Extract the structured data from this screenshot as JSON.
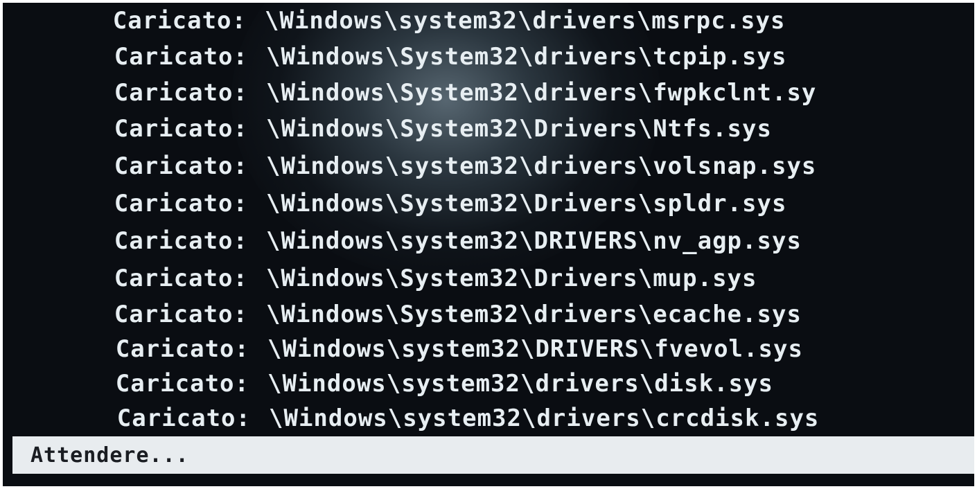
{
  "boot_log": {
    "label": "Caricato:",
    "entries": [
      {
        "prefix": "Caricato:",
        "path": "\\Windows\\system32\\drivers\\msrpc.sys"
      },
      {
        "prefix": "Caricato:",
        "path": "\\Windows\\System32\\drivers\\tcpip.sys"
      },
      {
        "prefix": "Caricato:",
        "path": "\\Windows\\System32\\drivers\\fwpkclnt.sy"
      },
      {
        "prefix": "Caricato:",
        "path": "\\Windows\\System32\\Drivers\\Ntfs.sys"
      },
      {
        "prefix": "Caricato:",
        "path": "\\Windows\\system32\\drivers\\volsnap.sys"
      },
      {
        "prefix": "Caricato:",
        "path": "\\Windows\\System32\\Drivers\\spldr.sys"
      },
      {
        "prefix": "Caricato:",
        "path": "\\Windows\\system32\\DRIVERS\\nv_agp.sys"
      },
      {
        "prefix": "Caricato:",
        "path": "\\Windows\\System32\\Drivers\\mup.sys"
      },
      {
        "prefix": "Caricato:",
        "path": "\\Windows\\System32\\drivers\\ecache.sys"
      },
      {
        "prefix": "Caricato:",
        "path": "\\Windows\\system32\\DRIVERS\\fvevol.sys"
      },
      {
        "prefix": "Caricato:",
        "path": "\\Windows\\system32\\drivers\\disk.sys"
      },
      {
        "prefix": "Caricato:",
        "path": "\\Windows\\system32\\drivers\\crcdisk.sys"
      }
    ]
  },
  "status_bar": {
    "text": "Attendere..."
  },
  "colors": {
    "background": "#0a0d12",
    "text": "#e7eef2",
    "status_bar_bg": "#e8ecef",
    "status_bar_text": "#1a1d22"
  }
}
